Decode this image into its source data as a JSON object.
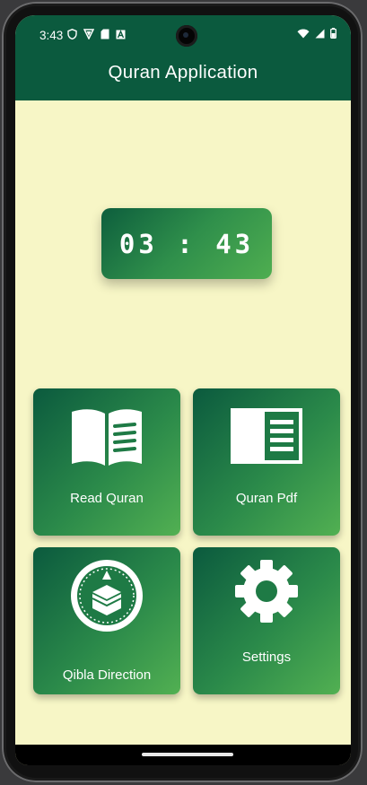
{
  "status_bar": {
    "time": "3:43"
  },
  "app_bar": {
    "title": "Quran Application"
  },
  "clock": {
    "display": "03 : 43"
  },
  "tiles": [
    {
      "label": "Read Quran",
      "icon": "open-book-icon"
    },
    {
      "label": "Quran Pdf",
      "icon": "document-icon"
    },
    {
      "label": "Qibla Direction",
      "icon": "kaaba-compass-icon"
    },
    {
      "label": "Settings",
      "icon": "gear-icon"
    }
  ],
  "colors": {
    "primary": "#0b5a3e",
    "accent": "#4fae50",
    "background": "#f7f6c6"
  }
}
